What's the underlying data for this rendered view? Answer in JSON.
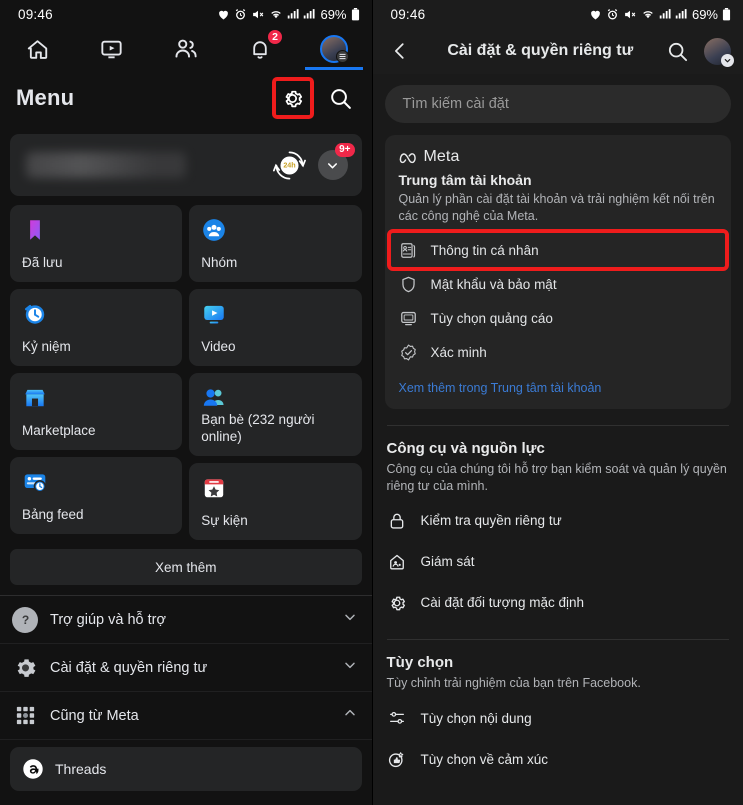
{
  "status_bar": {
    "time": "09:46",
    "battery": "69%",
    "icons": [
      "heart-icon",
      "alarm-icon",
      "mute-icon",
      "wifi-icon",
      "signal-1-icon",
      "signal-2-icon",
      "battery-icon"
    ]
  },
  "left_panel": {
    "nav_tabs": [
      {
        "name": "home",
        "icon": "home-icon",
        "badge": null,
        "active": false
      },
      {
        "name": "video",
        "icon": "video-icon",
        "badge": null,
        "active": false
      },
      {
        "name": "friends",
        "icon": "friends-icon",
        "badge": null,
        "active": false
      },
      {
        "name": "notifications",
        "icon": "bell-icon",
        "badge": "2",
        "active": false
      },
      {
        "name": "menu",
        "icon": "avatar-menu-icon",
        "badge": null,
        "active": true
      }
    ],
    "header": {
      "title": "Menu",
      "settings_icon": "gear-icon",
      "search_icon": "search-icon",
      "settings_highlighted": true
    },
    "profile_card": {
      "name_hidden": true,
      "story_badge": "24h",
      "expand_badge": "9+",
      "chevron_icon": "chevron-down-icon"
    },
    "grid": [
      {
        "label": "Đã lưu",
        "icon": "bookmark-icon"
      },
      {
        "label": "Nhóm",
        "icon": "groups-icon"
      },
      {
        "label": "Kỷ niệm",
        "icon": "memories-clock-icon"
      },
      {
        "label": "Video",
        "icon": "video-player-icon"
      },
      {
        "label": "Marketplace",
        "icon": "storefront-icon"
      },
      {
        "label": "Bạn bè (232 người online)",
        "icon": "friends-pair-icon"
      },
      {
        "label": "Bảng feed",
        "icon": "feeds-icon"
      },
      {
        "label": "Sự kiện",
        "icon": "calendar-star-icon"
      }
    ],
    "see_more": "Xem thêm",
    "rows": [
      {
        "label": "Trợ giúp và hỗ trợ",
        "icon": "help-question-icon",
        "chevron": "chevron-down-icon"
      },
      {
        "label": "Cài đặt & quyền riêng tư",
        "icon": "gear-icon",
        "chevron": "chevron-down-icon"
      },
      {
        "label": "Cũng từ Meta",
        "icon": "apps-grid-icon",
        "chevron": "chevron-up-icon"
      }
    ],
    "threads": {
      "label": "Threads",
      "icon": "threads-icon"
    }
  },
  "right_panel": {
    "header": {
      "title": "Cài đặt & quyền riêng tư",
      "back_icon": "back-arrow-icon",
      "search_icon": "search-icon",
      "avatar_icon": "avatar-icon"
    },
    "search": {
      "placeholder": "Tìm kiếm cài đặt",
      "value": ""
    },
    "meta_card": {
      "brand": "Meta",
      "brand_icon": "meta-infinity-icon",
      "heading": "Trung tâm tài khoản",
      "description": "Quản lý phần cài đặt tài khoản và trải nghiệm kết nối trên các công nghệ của Meta.",
      "items": [
        {
          "label": "Thông tin cá nhân",
          "icon": "id-card-icon",
          "highlighted": true
        },
        {
          "label": "Mật khẩu và bảo mật",
          "icon": "shield-icon",
          "highlighted": false
        },
        {
          "label": "Tùy chọn quảng cáo",
          "icon": "monitor-icon",
          "highlighted": false
        },
        {
          "label": "Xác minh",
          "icon": "verified-badge-icon",
          "highlighted": false
        }
      ],
      "link": "Xem thêm trong Trung tâm tài khoản"
    },
    "sections": [
      {
        "heading": "Công cụ và nguồn lực",
        "description": "Công cụ của chúng tôi hỗ trợ bạn kiểm soát và quản lý quyền riêng tư của mình.",
        "rows": [
          {
            "label": "Kiểm tra quyền riêng tư",
            "icon": "lock-icon"
          },
          {
            "label": "Giám sát",
            "icon": "supervision-icon"
          },
          {
            "label": "Cài đặt đối tượng mặc định",
            "icon": "gear-icon"
          }
        ]
      },
      {
        "heading": "Tùy chọn",
        "description": "Tùy chỉnh trải nghiệm của bạn trên Facebook.",
        "rows": [
          {
            "label": "Tùy chọn nội dung",
            "icon": "sliders-icon"
          },
          {
            "label": "Tùy chọn về cảm xúc",
            "icon": "reaction-like-icon"
          }
        ]
      }
    ]
  },
  "colors": {
    "accent_blue": "#1877f2",
    "badge_red": "#f02849",
    "highlight_red": "#ef1c1c",
    "link_blue": "#3b7bd4",
    "bg_left": "#121212",
    "bg_right": "#1a1a1a",
    "card": "#242526"
  }
}
